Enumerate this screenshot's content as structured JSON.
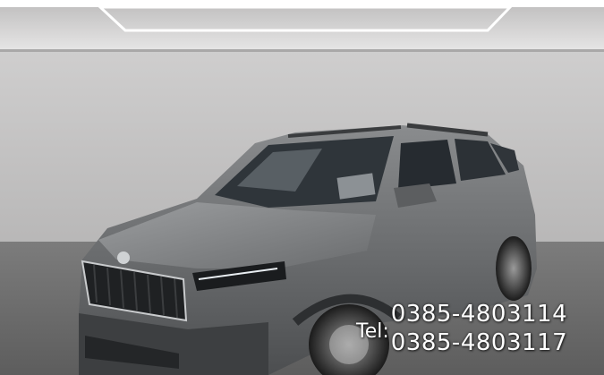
{
  "photo": {
    "subject": "grey compact SUV in showroom",
    "colors": {
      "wall": "#cfcdcd",
      "floor": "#8a8a8a",
      "car_body": "#6d6f71",
      "glass": "#2b3035",
      "ceiling_light": "#f4f4f4"
    }
  },
  "contact": {
    "tel_label": "Tel:",
    "phone_1": "0385-4803114",
    "phone_2": "0385-4803117"
  }
}
